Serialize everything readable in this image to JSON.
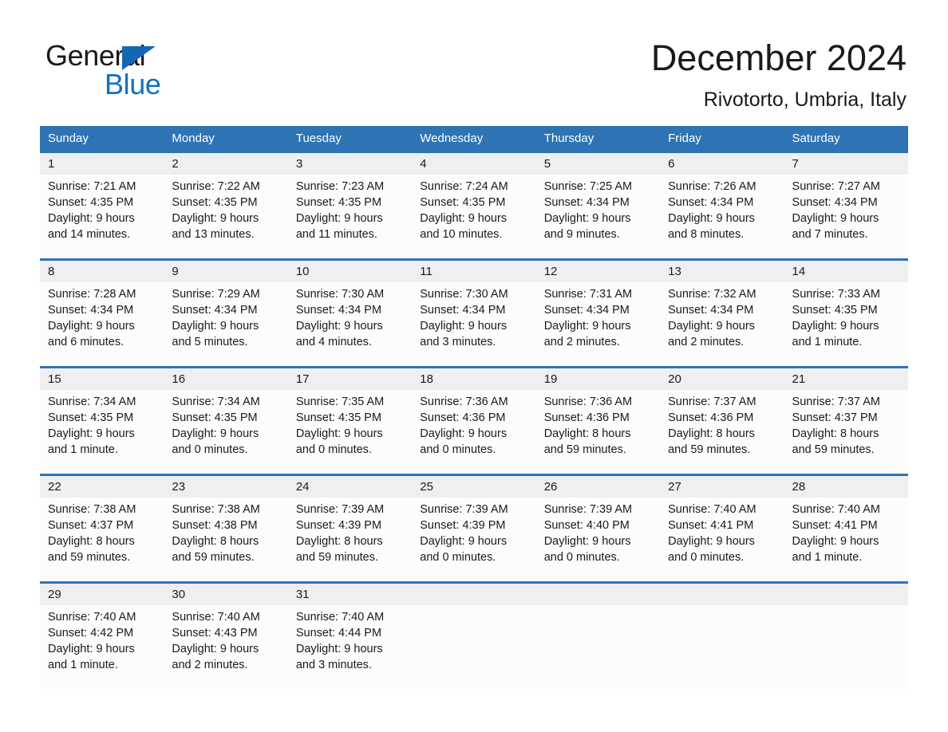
{
  "brand": {
    "name_part1": "General",
    "name_part2": "Blue",
    "logo_icon": "triangle-logo-icon",
    "accent_color": "#1071c0"
  },
  "header": {
    "month_title": "December 2024",
    "location": "Rivotorto, Umbria, Italy"
  },
  "calendar": {
    "header_color": "#2e74b5",
    "day_names": [
      "Sunday",
      "Monday",
      "Tuesday",
      "Wednesday",
      "Thursday",
      "Friday",
      "Saturday"
    ],
    "weeks": [
      {
        "dates": [
          "1",
          "2",
          "3",
          "4",
          "5",
          "6",
          "7"
        ],
        "cells": [
          {
            "sunrise": "Sunrise: 7:21 AM",
            "sunset": "Sunset: 4:35 PM",
            "daylight_line1": "Daylight: 9 hours",
            "daylight_line2": "and 14 minutes."
          },
          {
            "sunrise": "Sunrise: 7:22 AM",
            "sunset": "Sunset: 4:35 PM",
            "daylight_line1": "Daylight: 9 hours",
            "daylight_line2": "and 13 minutes."
          },
          {
            "sunrise": "Sunrise: 7:23 AM",
            "sunset": "Sunset: 4:35 PM",
            "daylight_line1": "Daylight: 9 hours",
            "daylight_line2": "and 11 minutes."
          },
          {
            "sunrise": "Sunrise: 7:24 AM",
            "sunset": "Sunset: 4:35 PM",
            "daylight_line1": "Daylight: 9 hours",
            "daylight_line2": "and 10 minutes."
          },
          {
            "sunrise": "Sunrise: 7:25 AM",
            "sunset": "Sunset: 4:34 PM",
            "daylight_line1": "Daylight: 9 hours",
            "daylight_line2": "and 9 minutes."
          },
          {
            "sunrise": "Sunrise: 7:26 AM",
            "sunset": "Sunset: 4:34 PM",
            "daylight_line1": "Daylight: 9 hours",
            "daylight_line2": "and 8 minutes."
          },
          {
            "sunrise": "Sunrise: 7:27 AM",
            "sunset": "Sunset: 4:34 PM",
            "daylight_line1": "Daylight: 9 hours",
            "daylight_line2": "and 7 minutes."
          }
        ]
      },
      {
        "dates": [
          "8",
          "9",
          "10",
          "11",
          "12",
          "13",
          "14"
        ],
        "cells": [
          {
            "sunrise": "Sunrise: 7:28 AM",
            "sunset": "Sunset: 4:34 PM",
            "daylight_line1": "Daylight: 9 hours",
            "daylight_line2": "and 6 minutes."
          },
          {
            "sunrise": "Sunrise: 7:29 AM",
            "sunset": "Sunset: 4:34 PM",
            "daylight_line1": "Daylight: 9 hours",
            "daylight_line2": "and 5 minutes."
          },
          {
            "sunrise": "Sunrise: 7:30 AM",
            "sunset": "Sunset: 4:34 PM",
            "daylight_line1": "Daylight: 9 hours",
            "daylight_line2": "and 4 minutes."
          },
          {
            "sunrise": "Sunrise: 7:30 AM",
            "sunset": "Sunset: 4:34 PM",
            "daylight_line1": "Daylight: 9 hours",
            "daylight_line2": "and 3 minutes."
          },
          {
            "sunrise": "Sunrise: 7:31 AM",
            "sunset": "Sunset: 4:34 PM",
            "daylight_line1": "Daylight: 9 hours",
            "daylight_line2": "and 2 minutes."
          },
          {
            "sunrise": "Sunrise: 7:32 AM",
            "sunset": "Sunset: 4:34 PM",
            "daylight_line1": "Daylight: 9 hours",
            "daylight_line2": "and 2 minutes."
          },
          {
            "sunrise": "Sunrise: 7:33 AM",
            "sunset": "Sunset: 4:35 PM",
            "daylight_line1": "Daylight: 9 hours",
            "daylight_line2": "and 1 minute."
          }
        ]
      },
      {
        "dates": [
          "15",
          "16",
          "17",
          "18",
          "19",
          "20",
          "21"
        ],
        "cells": [
          {
            "sunrise": "Sunrise: 7:34 AM",
            "sunset": "Sunset: 4:35 PM",
            "daylight_line1": "Daylight: 9 hours",
            "daylight_line2": "and 1 minute."
          },
          {
            "sunrise": "Sunrise: 7:34 AM",
            "sunset": "Sunset: 4:35 PM",
            "daylight_line1": "Daylight: 9 hours",
            "daylight_line2": "and 0 minutes."
          },
          {
            "sunrise": "Sunrise: 7:35 AM",
            "sunset": "Sunset: 4:35 PM",
            "daylight_line1": "Daylight: 9 hours",
            "daylight_line2": "and 0 minutes."
          },
          {
            "sunrise": "Sunrise: 7:36 AM",
            "sunset": "Sunset: 4:36 PM",
            "daylight_line1": "Daylight: 9 hours",
            "daylight_line2": "and 0 minutes."
          },
          {
            "sunrise": "Sunrise: 7:36 AM",
            "sunset": "Sunset: 4:36 PM",
            "daylight_line1": "Daylight: 8 hours",
            "daylight_line2": "and 59 minutes."
          },
          {
            "sunrise": "Sunrise: 7:37 AM",
            "sunset": "Sunset: 4:36 PM",
            "daylight_line1": "Daylight: 8 hours",
            "daylight_line2": "and 59 minutes."
          },
          {
            "sunrise": "Sunrise: 7:37 AM",
            "sunset": "Sunset: 4:37 PM",
            "daylight_line1": "Daylight: 8 hours",
            "daylight_line2": "and 59 minutes."
          }
        ]
      },
      {
        "dates": [
          "22",
          "23",
          "24",
          "25",
          "26",
          "27",
          "28"
        ],
        "cells": [
          {
            "sunrise": "Sunrise: 7:38 AM",
            "sunset": "Sunset: 4:37 PM",
            "daylight_line1": "Daylight: 8 hours",
            "daylight_line2": "and 59 minutes."
          },
          {
            "sunrise": "Sunrise: 7:38 AM",
            "sunset": "Sunset: 4:38 PM",
            "daylight_line1": "Daylight: 8 hours",
            "daylight_line2": "and 59 minutes."
          },
          {
            "sunrise": "Sunrise: 7:39 AM",
            "sunset": "Sunset: 4:39 PM",
            "daylight_line1": "Daylight: 8 hours",
            "daylight_line2": "and 59 minutes."
          },
          {
            "sunrise": "Sunrise: 7:39 AM",
            "sunset": "Sunset: 4:39 PM",
            "daylight_line1": "Daylight: 9 hours",
            "daylight_line2": "and 0 minutes."
          },
          {
            "sunrise": "Sunrise: 7:39 AM",
            "sunset": "Sunset: 4:40 PM",
            "daylight_line1": "Daylight: 9 hours",
            "daylight_line2": "and 0 minutes."
          },
          {
            "sunrise": "Sunrise: 7:40 AM",
            "sunset": "Sunset: 4:41 PM",
            "daylight_line1": "Daylight: 9 hours",
            "daylight_line2": "and 0 minutes."
          },
          {
            "sunrise": "Sunrise: 7:40 AM",
            "sunset": "Sunset: 4:41 PM",
            "daylight_line1": "Daylight: 9 hours",
            "daylight_line2": "and 1 minute."
          }
        ]
      },
      {
        "dates": [
          "29",
          "30",
          "31",
          "",
          "",
          "",
          ""
        ],
        "cells": [
          {
            "sunrise": "Sunrise: 7:40 AM",
            "sunset": "Sunset: 4:42 PM",
            "daylight_line1": "Daylight: 9 hours",
            "daylight_line2": "and 1 minute."
          },
          {
            "sunrise": "Sunrise: 7:40 AM",
            "sunset": "Sunset: 4:43 PM",
            "daylight_line1": "Daylight: 9 hours",
            "daylight_line2": "and 2 minutes."
          },
          {
            "sunrise": "Sunrise: 7:40 AM",
            "sunset": "Sunset: 4:44 PM",
            "daylight_line1": "Daylight: 9 hours",
            "daylight_line2": "and 3 minutes."
          },
          {
            "sunrise": "",
            "sunset": "",
            "daylight_line1": "",
            "daylight_line2": ""
          },
          {
            "sunrise": "",
            "sunset": "",
            "daylight_line1": "",
            "daylight_line2": ""
          },
          {
            "sunrise": "",
            "sunset": "",
            "daylight_line1": "",
            "daylight_line2": ""
          },
          {
            "sunrise": "",
            "sunset": "",
            "daylight_line1": "",
            "daylight_line2": ""
          }
        ]
      }
    ]
  }
}
